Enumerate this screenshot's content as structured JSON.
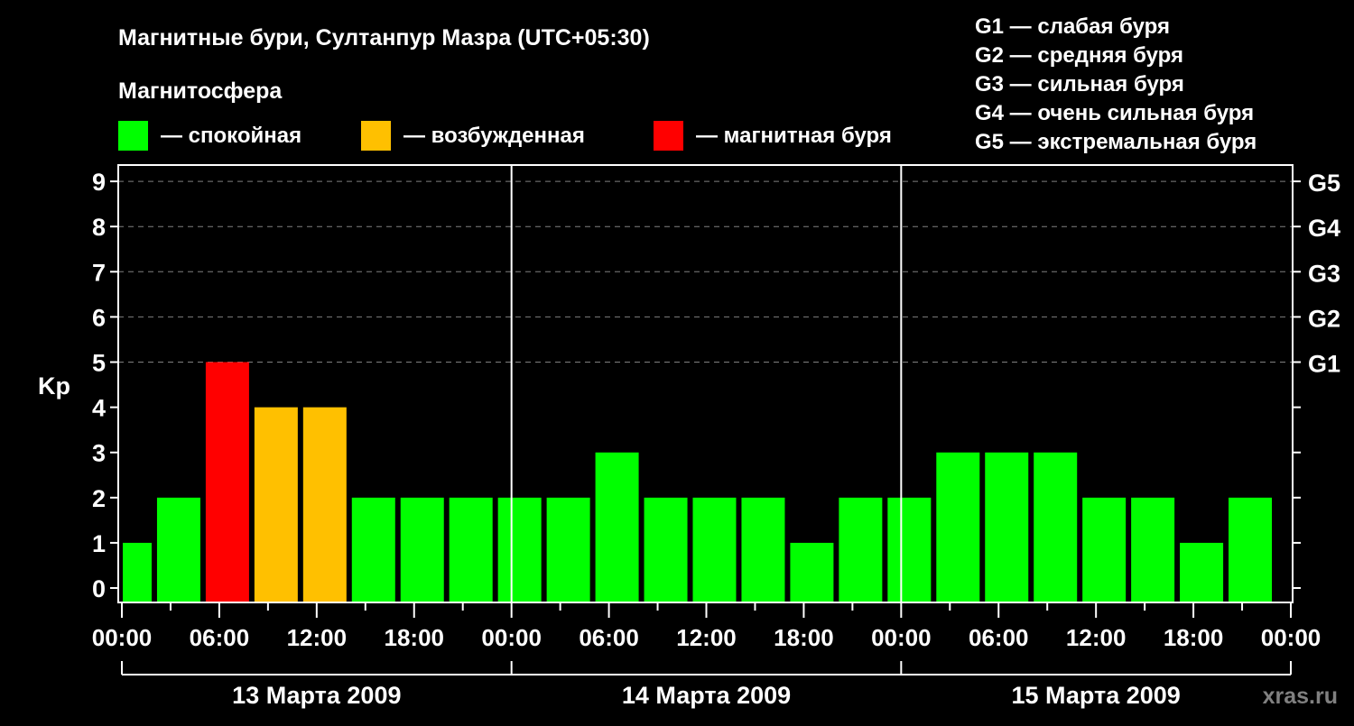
{
  "chart_data": {
    "type": "bar",
    "title": "Магнитные бури, Султанпур Мазра (UTC+05:30)",
    "legend_title": "Магнитосфера",
    "legend": [
      {
        "label": "— спокойная",
        "color": "#00ff00"
      },
      {
        "label": "— возбужденная",
        "color": "#ffc000"
      },
      {
        "label": "— магнитная буря",
        "color": "#ff0000"
      }
    ],
    "g_scale": [
      "G1 — слабая буря",
      "G2 — средняя буря",
      "G3 — сильная буря",
      "G4 — очень сильная буря",
      "G5 — экстремальная буря"
    ],
    "ylabel": "Kp",
    "ylim": [
      0,
      9
    ],
    "yticks": [
      "0",
      "1",
      "2",
      "3",
      "4",
      "5",
      "6",
      "7",
      "8",
      "9"
    ],
    "right_ticks": [
      {
        "kp": 5,
        "label": "G1"
      },
      {
        "kp": 6,
        "label": "G2"
      },
      {
        "kp": 7,
        "label": "G3"
      },
      {
        "kp": 8,
        "label": "G4"
      },
      {
        "kp": 9,
        "label": "G5"
      }
    ],
    "grid": "dashed horizontal at Kp 5-9",
    "xlim_hours": [
      0,
      72
    ],
    "xtick_labels": [
      "00:00",
      "06:00",
      "12:00",
      "18:00",
      "00:00",
      "06:00",
      "12:00",
      "18:00",
      "00:00",
      "06:00",
      "12:00",
      "18:00",
      "00:00"
    ],
    "days": [
      "13 Марта 2009",
      "14 Марта 2009",
      "15 Марта 2009"
    ],
    "bar_interval_hours": 3,
    "bar_center_hours_start": 0.5,
    "values": [
      1,
      2,
      5,
      4,
      4,
      2,
      2,
      2,
      2,
      2,
      3,
      2,
      2,
      2,
      1,
      2,
      2,
      3,
      3,
      3,
      2,
      2,
      1,
      2
    ],
    "colors": {
      "quiet": "#00ff00",
      "active": "#ffc000",
      "storm": "#ff0000"
    }
  },
  "watermark": "xras.ru"
}
